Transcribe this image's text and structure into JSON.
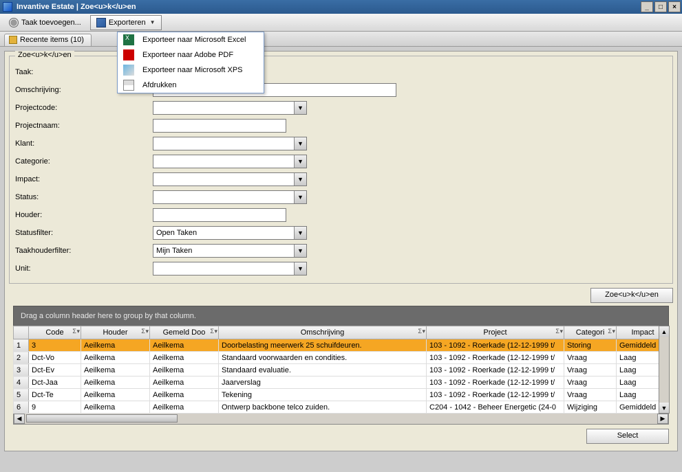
{
  "window": {
    "title": "Invantive Estate | Zoe<u>k</u>en"
  },
  "toolbar": {
    "task_add": "Taak toevoegen...",
    "export": "Exporteren",
    "recent_items": "Recente items (10)"
  },
  "export_menu": {
    "excel": "Exporteer naar Microsoft Excel",
    "pdf": "Exporteer naar Adobe PDF",
    "xps": "Exporteer naar Microsoft XPS",
    "print": "Afdrukken"
  },
  "groupbox": {
    "legend": "Zoe<u>k</u>en"
  },
  "form": {
    "labels": {
      "taak": "Taak:",
      "omschrijving": "Omschrijving:",
      "projectcode": "Projectcode:",
      "projectnaam": "Projectnaam:",
      "klant": "Klant:",
      "categorie": "Categorie:",
      "impact": "Impact:",
      "status": "Status:",
      "houder": "Houder:",
      "statusfilter": "Statusfilter:",
      "taakhouderfilter": "Taakhouderfilter:",
      "unit": "Unit:"
    },
    "values": {
      "taak": "",
      "omschrijving": "",
      "projectcode": "",
      "projectnaam": "",
      "klant": "",
      "categorie": "",
      "impact": "",
      "status": "",
      "houder": "",
      "statusfilter": "Open Taken",
      "taakhouderfilter": "Mijn Taken",
      "unit": ""
    }
  },
  "buttons": {
    "search": "Zoe<u>k</u>en",
    "select": "Select"
  },
  "grid": {
    "group_hint": "Drag a column header here to group by that column.",
    "columns": {
      "code": "Code",
      "houder": "Houder",
      "gemeld_door": "Gemeld Doo",
      "omschrijving": "Omschrijving",
      "project": "Project",
      "categorie": "Categori",
      "impact": "Impact"
    },
    "rows": [
      {
        "n": "1",
        "sel": true,
        "code": "3",
        "houder": "Aeilkema",
        "gemeld": "Aeilkema",
        "omschr": "Doorbelasting meerwerk 25 schuifdeuren.",
        "project": "103 - 1092 - Roerkade (12-12-1999 t/",
        "cat": "Storing",
        "impact": "Gemiddeld"
      },
      {
        "n": "2",
        "code": "Dct-Vo",
        "houder": "Aeilkema",
        "gemeld": "Aeilkema",
        "omschr": "Standaard voorwaarden en condities.",
        "project": "103 - 1092 - Roerkade (12-12-1999 t/",
        "cat": "Vraag",
        "impact": "Laag"
      },
      {
        "n": "3",
        "code": "Dct-Ev",
        "houder": "Aeilkema",
        "gemeld": "Aeilkema",
        "omschr": "Standaard evaluatie.",
        "project": "103 - 1092 - Roerkade (12-12-1999 t/",
        "cat": "Vraag",
        "impact": "Laag"
      },
      {
        "n": "4",
        "code": "Dct-Jaa",
        "houder": "Aeilkema",
        "gemeld": "Aeilkema",
        "omschr": "Jaarverslag",
        "project": "103 - 1092 - Roerkade (12-12-1999 t/",
        "cat": "Vraag",
        "impact": "Laag"
      },
      {
        "n": "5",
        "code": "Dct-Te",
        "houder": "Aeilkema",
        "gemeld": "Aeilkema",
        "omschr": "Tekening",
        "project": "103 - 1092 - Roerkade (12-12-1999 t/",
        "cat": "Vraag",
        "impact": "Laag"
      },
      {
        "n": "6",
        "code": "9",
        "houder": "Aeilkema",
        "gemeld": "Aeilkema",
        "omschr": "Ontwerp backbone telco zuiden.",
        "project": "C204 - 1042 - Beheer Energetic (24-0",
        "cat": "Wijziging",
        "impact": "Gemiddeld"
      }
    ]
  }
}
